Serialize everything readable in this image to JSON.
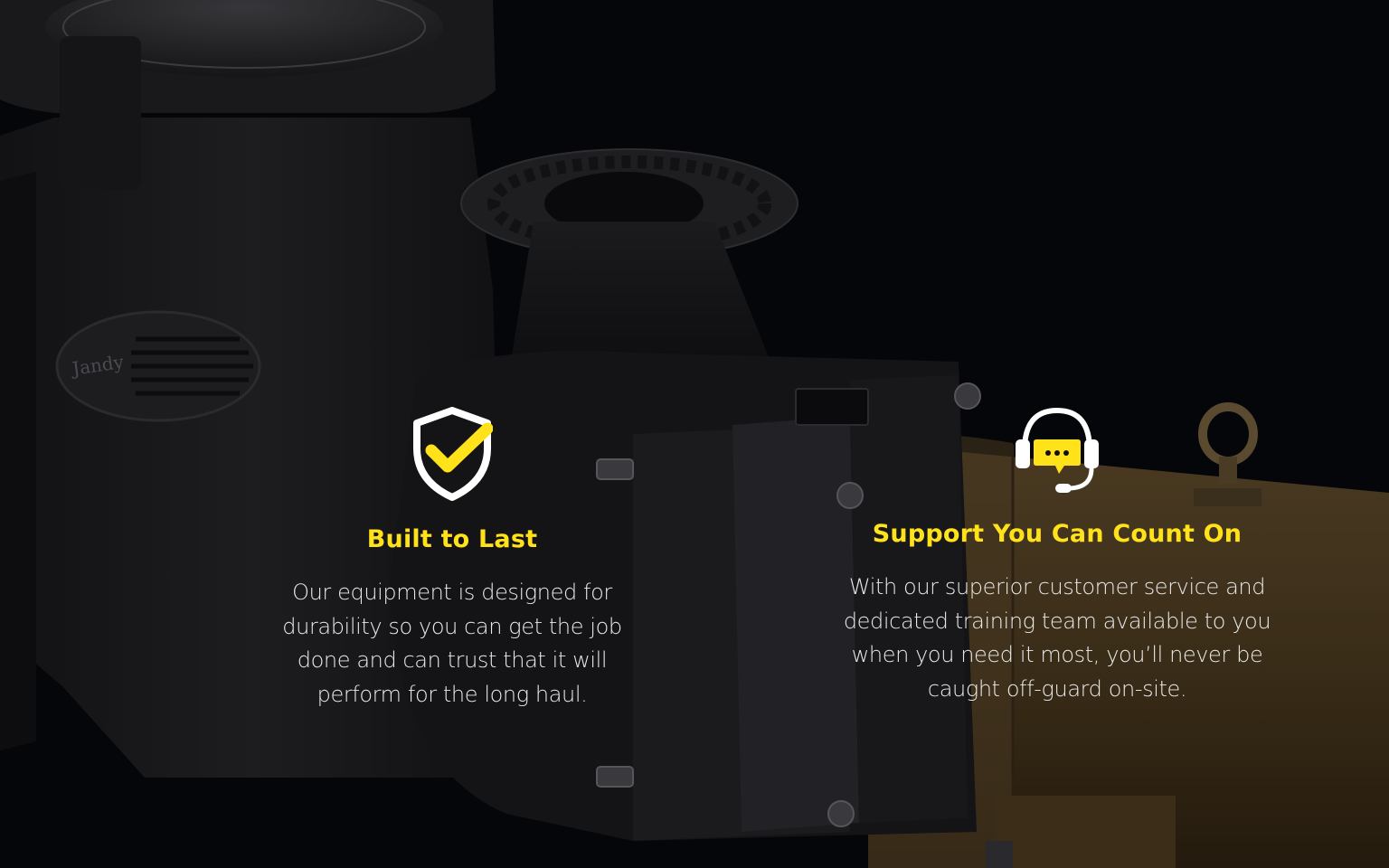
{
  "colors": {
    "accent": "#ffe21a",
    "background": "#050609",
    "body_text": "#e9e9e9"
  },
  "features": [
    {
      "icon": "shield-check-icon",
      "title": "Built to Last",
      "body": "Our equipment is designed for durability so you can get the job done and can trust that it will perform for the long haul."
    },
    {
      "icon": "headset-chat-icon",
      "title": "Support You Can Count On",
      "body": "With our superior customer service and dedicated training team available to you when you need it most, you’ll never be caught off-guard on-site."
    }
  ],
  "background_image": {
    "logo_text": "Jandy"
  }
}
